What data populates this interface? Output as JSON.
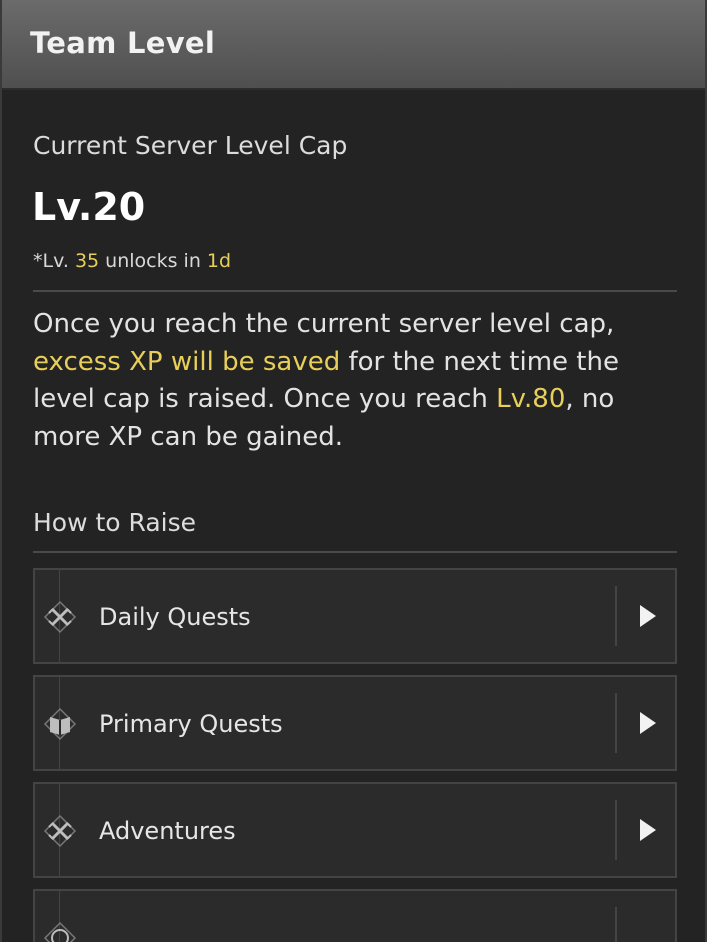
{
  "header": {
    "title": "Team Level"
  },
  "level_cap": {
    "label": "Current Server Level Cap",
    "value": "Lv.20",
    "unlock_prefix": "*Lv. ",
    "unlock_level": "35",
    "unlock_middle": " unlocks in ",
    "unlock_time": "1d"
  },
  "description": {
    "part1": "Once you reach the current server level cap, ",
    "highlight1": "excess XP will be saved",
    "part2": " for the next time the level cap is raised. Once you reach ",
    "highlight2": "Lv.80",
    "part3": ", no more XP can be gained."
  },
  "how_to_raise": {
    "label": "How to Raise",
    "items": [
      {
        "label": "Daily Quests",
        "icon": "daily-quests-icon"
      },
      {
        "label": "Primary Quests",
        "icon": "primary-quests-icon"
      },
      {
        "label": "Adventures",
        "icon": "adventures-icon"
      }
    ]
  },
  "colors": {
    "highlight": "#e8cf5a",
    "header": "#5e5e5e",
    "panel": "#232323"
  }
}
